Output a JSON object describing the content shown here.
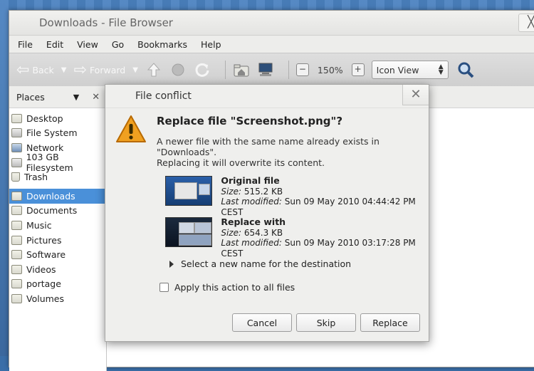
{
  "window": {
    "title": "Downloads - File Browser",
    "control_glyph": "╳"
  },
  "menubar": [
    "File",
    "Edit",
    "View",
    "Go",
    "Bookmarks",
    "Help"
  ],
  "toolbar": {
    "back_label": "Back",
    "forward_label": "Forward",
    "zoom_level": "150%",
    "view_mode": "Icon View"
  },
  "sidebar": {
    "header": "Places",
    "items": [
      {
        "label": "Desktop",
        "icon": "folder-icon"
      },
      {
        "label": "File System",
        "icon": "drive-icon"
      },
      {
        "label": "Network",
        "icon": "network-icon"
      },
      {
        "label": "103 GB Filesystem",
        "icon": "drive-icon"
      },
      {
        "label": "Trash",
        "icon": "trash-icon"
      },
      {
        "label": "Downloads",
        "icon": "folder-icon",
        "selected": true
      },
      {
        "label": "Documents",
        "icon": "folder-icon"
      },
      {
        "label": "Music",
        "icon": "folder-icon"
      },
      {
        "label": "Pictures",
        "icon": "folder-icon"
      },
      {
        "label": "Software",
        "icon": "folder-icon"
      },
      {
        "label": "Videos",
        "icon": "folder-icon"
      },
      {
        "label": "portage",
        "icon": "folder-icon"
      },
      {
        "label": "Volumes",
        "icon": "folder-icon"
      }
    ]
  },
  "dialog": {
    "title": "File conflict",
    "heading": "Replace file \"Screenshot.png\"?",
    "message_line1": "A newer file with the same name already exists in",
    "message_line2": "\"Downloads\".",
    "message_line3": "Replacing it will overwrite its content.",
    "original": {
      "name": "Original file",
      "size_label": "Size:",
      "size": "515.2 KB",
      "modified_label": "Last modified:",
      "modified": "Sun 09 May 2010 04:44:42 PM CEST"
    },
    "replacement": {
      "name": "Replace with",
      "size_label": "Size:",
      "size": "654.3 KB",
      "modified_label": "Last modified:",
      "modified": "Sun 09 May 2010 03:17:28 PM CEST"
    },
    "expander_label": "Select a new name for the destination",
    "apply_all_label": "Apply this action to all files",
    "apply_all_checked": false,
    "buttons": {
      "cancel": "Cancel",
      "skip": "Skip",
      "replace": "Replace"
    }
  },
  "colors": {
    "selection": "#4a90d9",
    "warning": "#f0a020",
    "desktop": "#3a6ea8"
  }
}
